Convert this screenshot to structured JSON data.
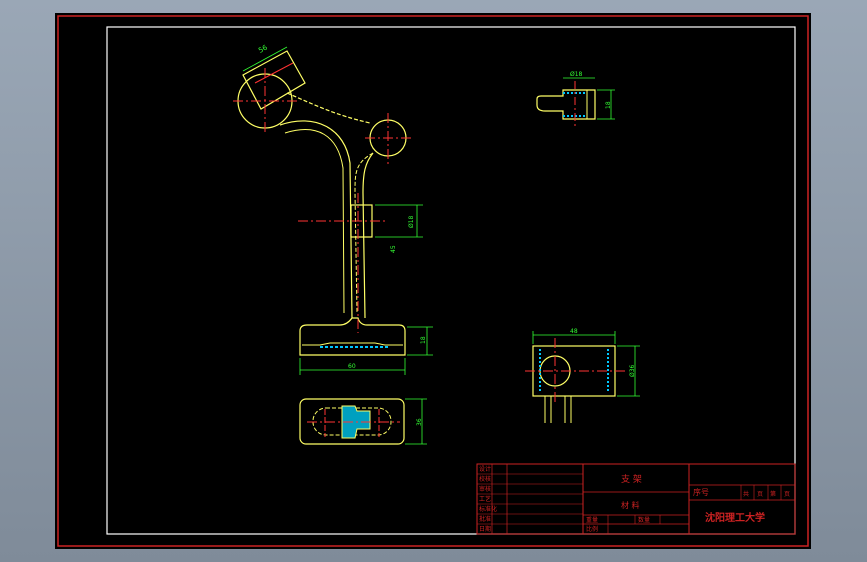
{
  "title_block": {
    "part_name": "支 架",
    "material_label": "材 料",
    "serial_label": "序号",
    "school": "沈阳理工大学",
    "left_col": [
      "设计",
      "校核",
      "审核",
      "工艺",
      "标准化",
      "批准",
      "日期"
    ],
    "sheet_cells": [
      "共",
      "页",
      "第",
      "页"
    ],
    "bottom_cells": [
      "重量",
      "比例",
      "数量"
    ]
  },
  "dimensions": {
    "top_arm": "56",
    "small_w": "Ø18",
    "small_h": "18",
    "stem_w": "Ø18",
    "stem_off": "45",
    "base_h": "18",
    "base_w": "60",
    "slot_h": "36",
    "right_w": "48",
    "right_h": "Ø36"
  },
  "colors": {
    "outline": "#ffffff",
    "part": "#ffff66",
    "dimension": "#33ff33",
    "center": "#ff3333",
    "frame": "#cc2222",
    "section": "#00c8ff"
  }
}
